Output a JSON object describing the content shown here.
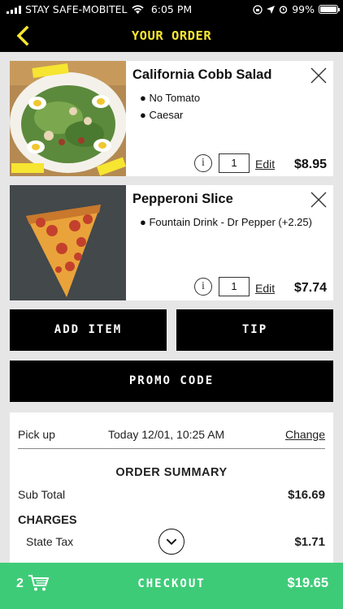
{
  "status_bar": {
    "carrier": "STAY SAFE-MOBITEL",
    "time": "6:05 PM",
    "battery": "99%"
  },
  "header": {
    "title": "YOUR ORDER",
    "back_icon": "chevron-left-icon",
    "accent_color": "#f6e531"
  },
  "items": [
    {
      "name": "California Cobb Salad",
      "options": [
        "No Tomato",
        "Caesar"
      ],
      "quantity": "1",
      "edit_label": "Edit",
      "price": "$8.95",
      "image": "salad-photo"
    },
    {
      "name": "Pepperoni Slice",
      "options": [
        "Fountain Drink - Dr Pepper (+2.25)"
      ],
      "quantity": "1",
      "edit_label": "Edit",
      "price": "$7.74",
      "image": "pizza-photo"
    }
  ],
  "buttons": {
    "add_item": "ADD ITEM",
    "tip": "TIP",
    "promo_code": "PROMO CODE"
  },
  "pickup": {
    "label": "Pick up",
    "time": "Today 12/01, 10:25 AM",
    "change_label": "Change"
  },
  "summary": {
    "title": "ORDER SUMMARY",
    "subtotal_label": "Sub Total",
    "subtotal_value": "$16.69",
    "charges_label": "CHARGES",
    "state_tax_label": "State Tax",
    "state_tax_value": "$1.71"
  },
  "checkout": {
    "item_count": "2",
    "label": "CHECKOUT",
    "total": "$19.65",
    "bar_color": "#3ecb78"
  }
}
